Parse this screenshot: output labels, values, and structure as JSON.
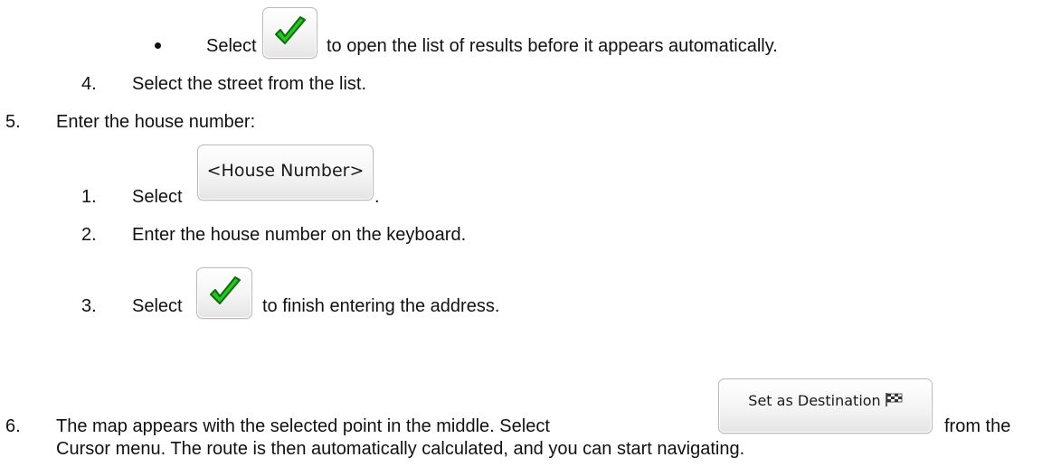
{
  "items": {
    "bullet_select": {
      "prefix": "Select",
      "suffix": "to open the list of results before it appears automatically.",
      "button_icon": "green-checkmark-icon"
    },
    "step4": {
      "number": "4.",
      "text": "Select the street from the list."
    },
    "step5": {
      "number": "5.",
      "text": "Enter the house number:",
      "sub": [
        {
          "number": "1.",
          "prefix": "Select",
          "button_label": "<House Number>",
          "suffix": "."
        },
        {
          "number": "2.",
          "text": "Enter the house number on the keyboard."
        },
        {
          "number": "3.",
          "prefix": "Select",
          "button_icon": "green-checkmark-icon",
          "suffix": "to finish entering the address."
        }
      ]
    },
    "step6": {
      "number": "6.",
      "line1_prefix": "The map appears with the selected point in the middle. Select",
      "button_label": "Set as Destination",
      "button_icon": "checkered-flag-icon",
      "line1_suffix": "from the",
      "line2": "Cursor menu. The route is then automatically calculated, and you can start navigating."
    }
  },
  "colors": {
    "check_green": "#22c81e",
    "check_outline": "#0f6a10",
    "button_border": "#b9b9b9"
  }
}
